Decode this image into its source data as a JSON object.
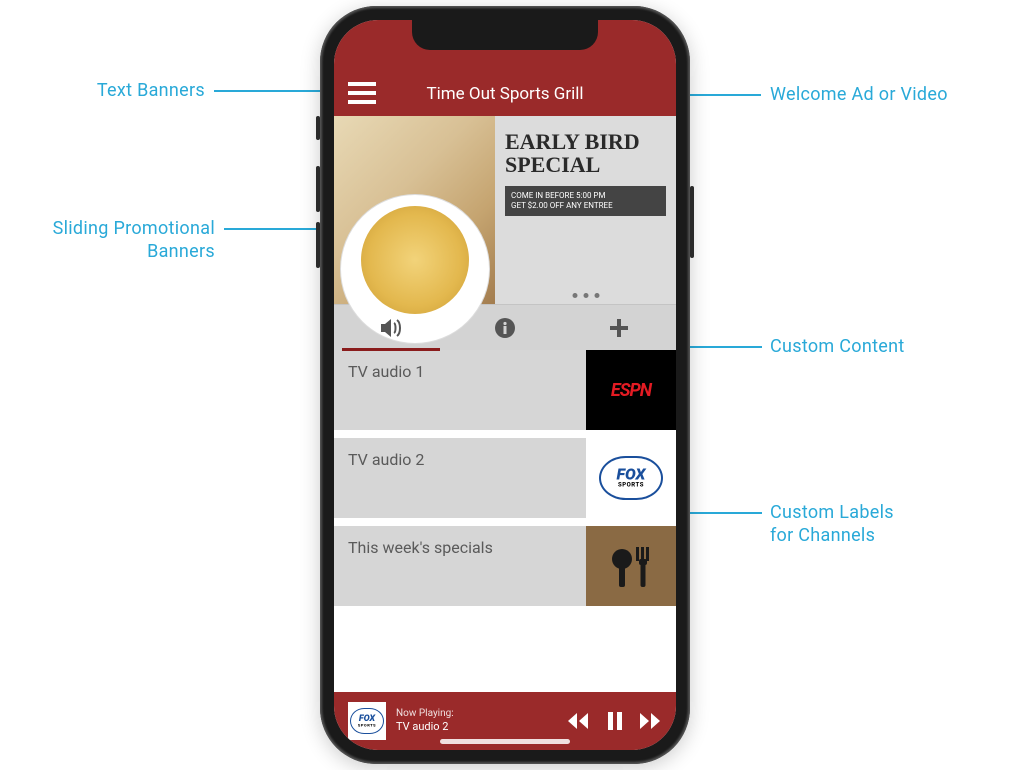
{
  "annotations": {
    "text_banners": "Text Banners",
    "welcome_ad": "Welcome Ad or Video",
    "sliding_banners_line1": "Sliding Promotional",
    "sliding_banners_line2": "Banners",
    "custom_content": "Custom Content",
    "custom_labels_line1": "Custom Labels",
    "custom_labels_line2": "for Channels"
  },
  "app": {
    "title": "Time Out Sports Grill"
  },
  "promo": {
    "title_line1": "EARLY BIRD",
    "title_line2": "SPECIAL",
    "badge_line1": "COME IN BEFORE 5:00 PM",
    "badge_line2": "GET $2.00 OFF ANY ENTREE"
  },
  "tabs": {
    "audio_icon": "speaker-icon",
    "info_icon": "info-icon",
    "plus_icon": "plus-icon"
  },
  "channels": [
    {
      "label": "TV audio 1",
      "logo": "espn",
      "logo_text": "ESPN"
    },
    {
      "label": "TV audio 2",
      "logo": "fox",
      "logo_text": "FOX",
      "logo_sub": "SPORTS"
    },
    {
      "label": "This week's specials",
      "logo": "food"
    }
  ],
  "player": {
    "now_playing_label": "Now Playing:",
    "track": "TV audio 2",
    "mini_logo_text": "FOX",
    "mini_logo_sub": "SPORTS"
  }
}
